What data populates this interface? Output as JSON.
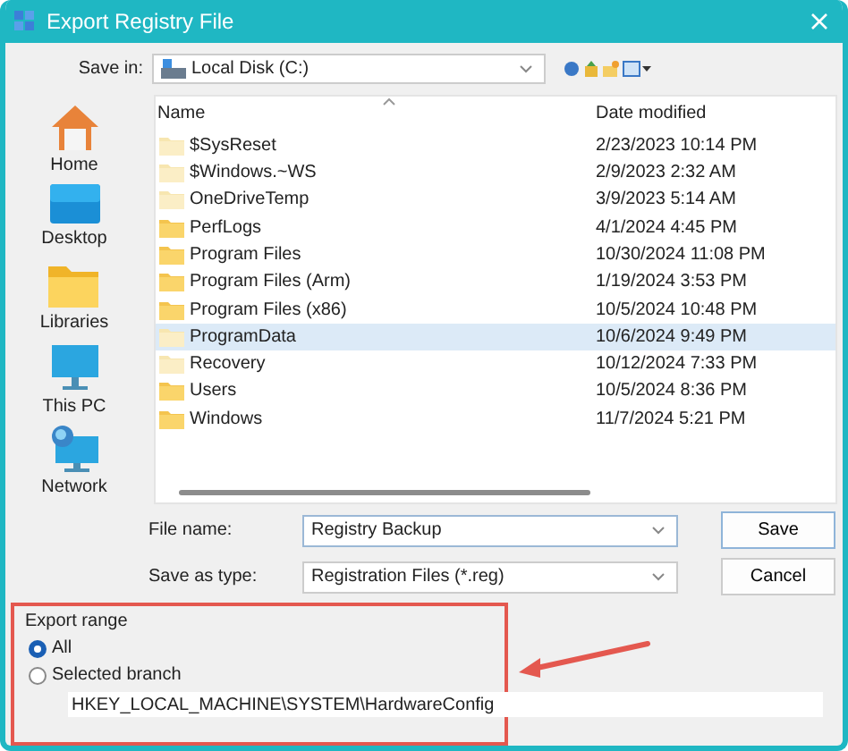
{
  "window": {
    "title": "Export Registry File"
  },
  "save_in": {
    "label": "Save in:",
    "value": "Local Disk (C:)"
  },
  "sidebar": {
    "items": [
      {
        "label": "Home",
        "kind": "home"
      },
      {
        "label": "Desktop",
        "kind": "desktop"
      },
      {
        "label": "Libraries",
        "kind": "libraries"
      },
      {
        "label": "This PC",
        "kind": "pc"
      },
      {
        "label": "Network",
        "kind": "network"
      }
    ]
  },
  "table": {
    "columns": [
      "Name",
      "Date modified"
    ],
    "rows": [
      {
        "name": "$SysReset",
        "date": "2/23/2023 10:14 PM",
        "hidden": true,
        "selected": false
      },
      {
        "name": "$Windows.~WS",
        "date": "2/9/2023 2:32 AM",
        "hidden": true,
        "selected": false
      },
      {
        "name": "OneDriveTemp",
        "date": "3/9/2023 5:14 AM",
        "hidden": true,
        "selected": false
      },
      {
        "name": "PerfLogs",
        "date": "4/1/2024 4:45 PM",
        "hidden": false,
        "selected": false
      },
      {
        "name": "Program Files",
        "date": "10/30/2024 11:08 PM",
        "hidden": false,
        "selected": false
      },
      {
        "name": "Program Files (Arm)",
        "date": "1/19/2024 3:53 PM",
        "hidden": false,
        "selected": false
      },
      {
        "name": "Program Files (x86)",
        "date": "10/5/2024 10:48 PM",
        "hidden": false,
        "selected": false
      },
      {
        "name": "ProgramData",
        "date": "10/6/2024 9:49 PM",
        "hidden": true,
        "selected": true
      },
      {
        "name": "Recovery",
        "date": "10/12/2024 7:33 PM",
        "hidden": true,
        "selected": false
      },
      {
        "name": "Users",
        "date": "10/5/2024 8:36 PM",
        "hidden": false,
        "selected": false
      },
      {
        "name": "Windows",
        "date": "11/7/2024 5:21 PM",
        "hidden": false,
        "selected": false
      }
    ]
  },
  "file_name": {
    "label": "File name:",
    "value": "Registry Backup"
  },
  "save_as_type": {
    "label": "Save as type:",
    "value": "Registration Files (*.reg)"
  },
  "buttons": [
    "Save",
    "Cancel"
  ],
  "export_range": {
    "title": "Export range",
    "options": [
      {
        "label": "All",
        "selected": true
      },
      {
        "label": "Selected branch",
        "selected": false
      }
    ],
    "branch": "HKEY_LOCAL_MACHINE\\SYSTEM\\HardwareConfig"
  }
}
